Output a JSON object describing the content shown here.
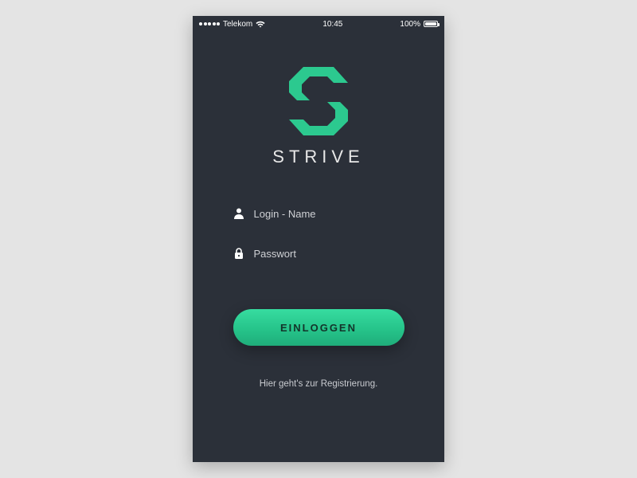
{
  "status_bar": {
    "carrier": "Telekom",
    "time": "10:45",
    "battery_pct": "100%"
  },
  "brand": {
    "name": "STRIVE"
  },
  "form": {
    "login_placeholder": "Login - Name",
    "password_placeholder": "Passwort",
    "submit_label": "EINLOGGEN"
  },
  "register_link": "Hier geht's zur Registrierung.",
  "colors": {
    "accent": "#2cc98f",
    "bg": "#2b3039"
  }
}
